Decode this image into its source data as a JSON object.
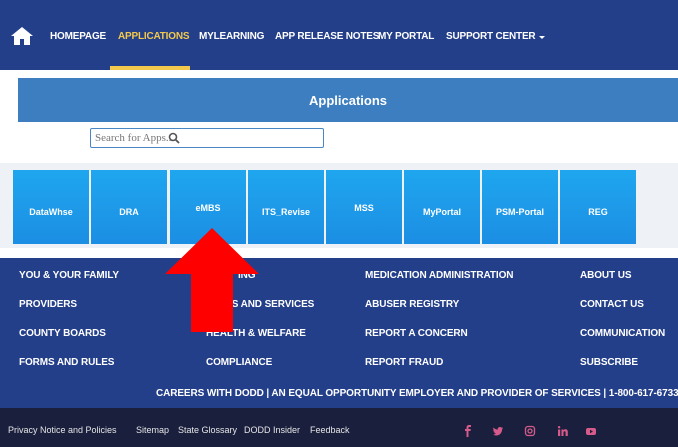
{
  "nav": {
    "items": [
      "HOMEPAGE",
      "APPLICATIONS",
      "MYLEARNING",
      "APP RELEASE NOTES",
      "MY PORTAL",
      "SUPPORT CENTER"
    ]
  },
  "apps": {
    "title": "Applications",
    "search_placeholder": "Search for Apps...",
    "tiles": [
      "DataWhse",
      "DRA",
      "eMBS",
      "ITS_Revise",
      "MSS",
      "MyPortal",
      "PSM-Portal",
      "REG"
    ]
  },
  "footer": {
    "col1": [
      "YOU & YOUR FAMILY",
      "PROVIDERS",
      "COUNTY BOARDS",
      "FORMS AND RULES"
    ],
    "col2": [
      "ING",
      "ERS AND SERVICES",
      "HEALTH & WELFARE",
      "COMPLIANCE"
    ],
    "col3": [
      "MEDICATION ADMINISTRATION",
      "ABUSER REGISTRY",
      "REPORT A CONCERN",
      "REPORT FRAUD"
    ],
    "col4": [
      "ABOUT US",
      "CONTACT US",
      "COMMUNICATION",
      "SUBSCRIBE"
    ],
    "careers": "CAREERS WITH DODD | AN EQUAL OPPORTUNITY EMPLOYER AND PROVIDER OF SERVICES | 1-800-617-6733"
  },
  "bottom": {
    "links": [
      "Privacy Notice and Policies",
      "Sitemap",
      "State Glossary",
      "DODD Insider",
      "Feedback"
    ],
    "social_icons": [
      "facebook-icon",
      "twitter-icon",
      "instagram-icon",
      "linkedin-icon",
      "youtube-icon"
    ]
  },
  "colors": {
    "nav_bg": "#243f8a",
    "active": "#f2c94c",
    "header_bg": "#3d7ec0",
    "tile": "#1c9be8",
    "arrow": "#ff0000",
    "bottom_bg": "#1a1f3d"
  }
}
